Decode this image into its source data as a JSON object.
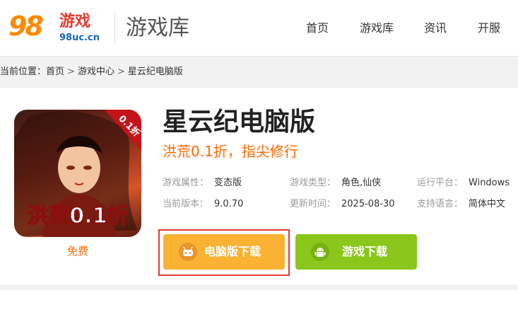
{
  "header": {
    "logo": {
      "number": "98",
      "name": "游戏",
      "domain": "98uc.cn"
    },
    "site_title": "游戏库",
    "nav": [
      "首页",
      "游戏库",
      "资讯",
      "开服"
    ]
  },
  "breadcrumb": {
    "prefix": "当前位置：",
    "items": [
      "首页",
      "游戏中心",
      "星云纪电脑版"
    ],
    "separator": ">"
  },
  "game": {
    "title": "星云纪电脑版",
    "slogan": "洪荒0.1折，指尖修行",
    "price": "免费",
    "cover": {
      "badge": "0.1折",
      "banner": "洪荒0.1折"
    },
    "attributes": [
      {
        "key": "游戏属性：",
        "value": "变态版"
      },
      {
        "key": "游戏类型：",
        "value": "角色,仙侠"
      },
      {
        "key": "运行平台：",
        "value": "Windows"
      },
      {
        "key": "当前版本：",
        "value": "9.0.70"
      },
      {
        "key": "更新时间：",
        "value": "2025-08-30"
      },
      {
        "key": "支持语言：",
        "value": "简体中文"
      }
    ]
  },
  "buttons": {
    "pc_download": "电脑版下载",
    "game_download": "游戏下载"
  },
  "colors": {
    "accent_orange": "#ff6a00",
    "pc_button": "#f9b234",
    "game_button": "#8bc61d",
    "highlight_border": "#e53935"
  },
  "icons": {
    "pc_button": "gamepad-robot-icon",
    "game_button": "android-icon"
  }
}
